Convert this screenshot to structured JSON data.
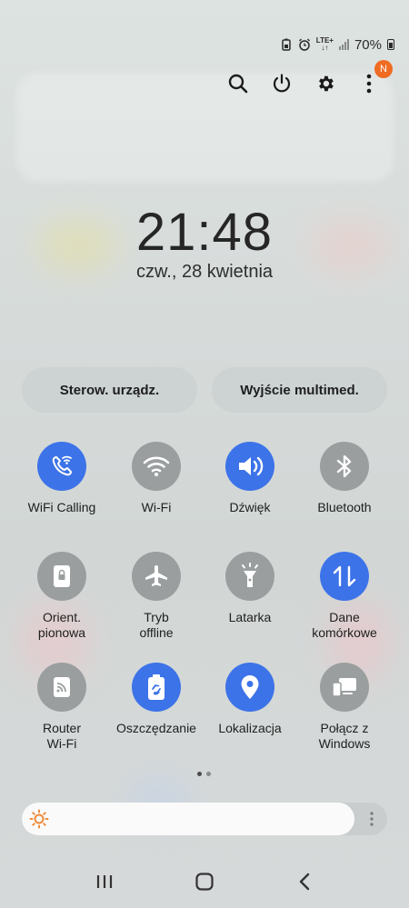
{
  "status_bar": {
    "lte_label": "LTE+",
    "battery_text": "70%"
  },
  "top_actions": {
    "badge_text": "N",
    "icons": [
      "search-icon",
      "power-icon",
      "gear-icon",
      "more-vert-icon"
    ]
  },
  "clock": {
    "time": "21:48",
    "date": "czw., 28 kwietnia"
  },
  "pills": {
    "devices_label": "Sterow. urządz.",
    "media_label": "Wyjście multimed."
  },
  "tiles": [
    {
      "label": "WiFi Calling",
      "icon": "wifi-calling-icon",
      "active": true
    },
    {
      "label": "Wi-Fi",
      "icon": "wifi-icon",
      "active": false
    },
    {
      "label": "Dźwięk",
      "icon": "sound-icon",
      "active": true
    },
    {
      "label": "Bluetooth",
      "icon": "bluetooth-icon",
      "active": false
    },
    {
      "label": "Orient.\npionowa",
      "icon": "orientation-lock-icon",
      "active": false
    },
    {
      "label": "Tryb\noffline",
      "icon": "airplane-icon",
      "active": false
    },
    {
      "label": "Latarka",
      "icon": "flashlight-icon",
      "active": false
    },
    {
      "label": "Dane\nkomórkowe",
      "icon": "mobile-data-icon",
      "active": true
    },
    {
      "label": "Router\nWi-Fi",
      "icon": "hotspot-icon",
      "active": false
    },
    {
      "label": "Oszczędzanie",
      "icon": "battery-saver-icon",
      "active": true
    },
    {
      "label": "Lokalizacja",
      "icon": "location-icon",
      "active": true
    },
    {
      "label": "Połącz z\nWindows",
      "icon": "link-windows-icon",
      "active": false
    }
  ],
  "pager": {
    "pages": 2,
    "current": 1
  },
  "brightness": {
    "level": 0.91
  },
  "colors": {
    "active": "#3d73e8",
    "inactive": "#9a9e9f",
    "badge": "#ef6c22",
    "sun": "#f08a3a"
  }
}
